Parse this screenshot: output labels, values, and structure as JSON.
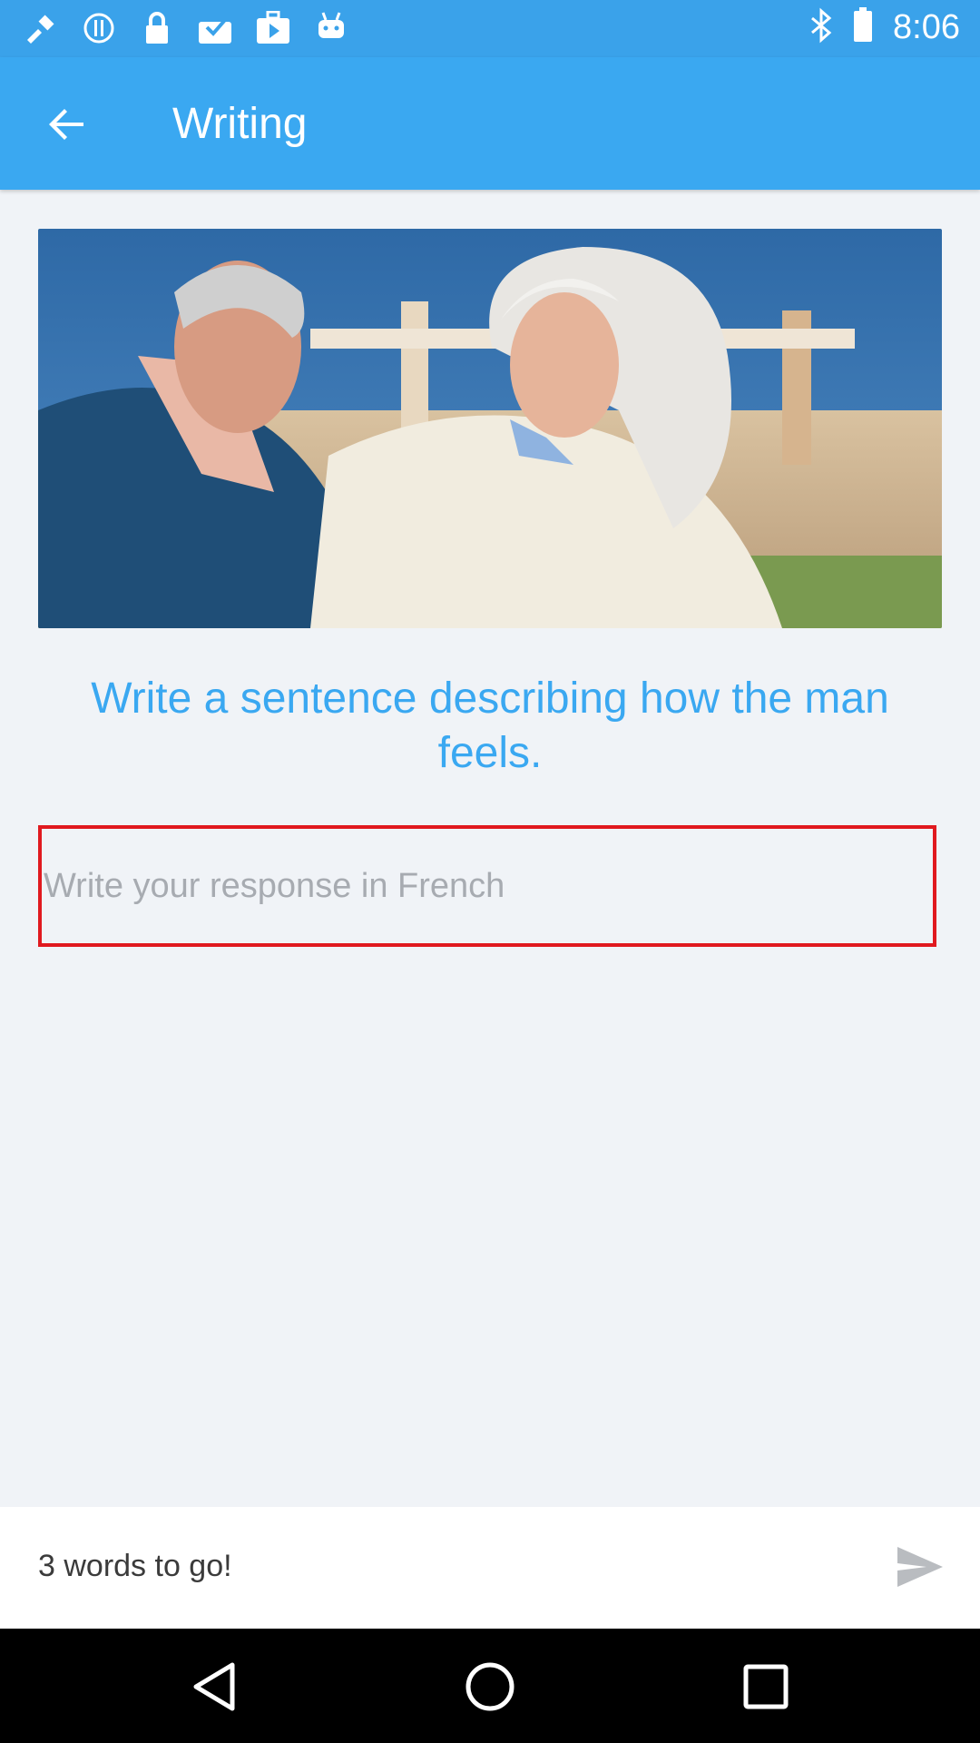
{
  "status_bar": {
    "time": "8:06",
    "left_icons": [
      "fake-gps-icon",
      "info-icon",
      "lock-icon",
      "task-icon",
      "play-store-icon",
      "android-icon"
    ],
    "right_icons": [
      "bluetooth-icon"
    ]
  },
  "app_bar": {
    "title": "Writing",
    "back_icon": "arrow-back-icon"
  },
  "main": {
    "photo_subject": "older couple sitting by the sea",
    "prompt": "Write a sentence describing how the man feels.",
    "response": {
      "placeholder": "Write your response in French",
      "value": ""
    }
  },
  "bottom_bar": {
    "words_left": "3 words to go!",
    "send_icon": "send-icon"
  },
  "nav_bar": {
    "icons": [
      "back-triangle-icon",
      "home-circle-icon",
      "recents-square-icon"
    ]
  },
  "colors": {
    "accent": "#3aa8f1",
    "status_bar": "#3aa2ea",
    "error_border": "#e0191f",
    "background": "#f0f3f7"
  }
}
